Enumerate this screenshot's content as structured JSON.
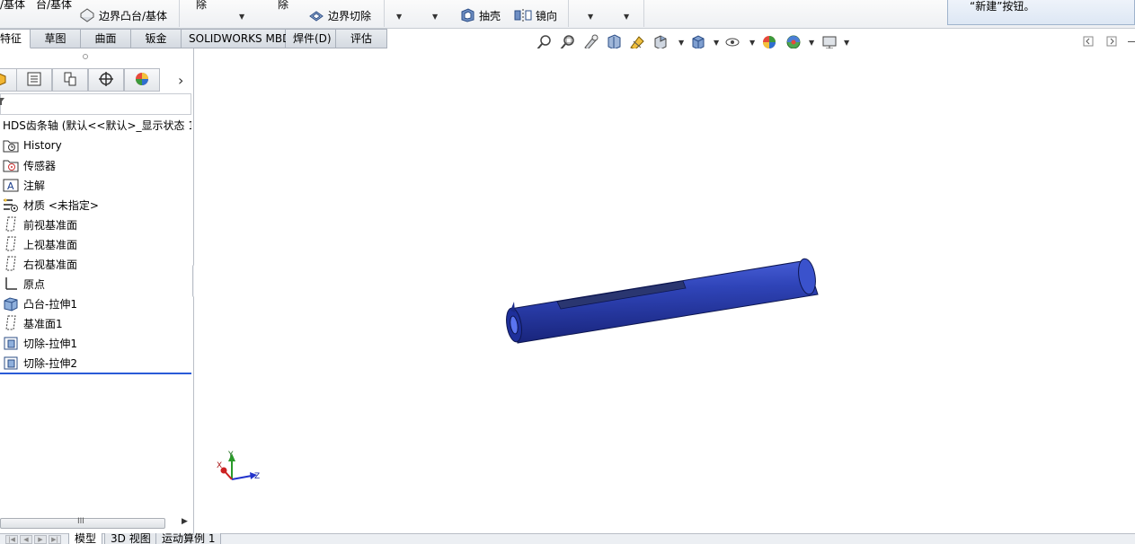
{
  "ribbon": {
    "top_fragments": [
      "/基体",
      "台/基体"
    ],
    "boundary_boss_label": "边界凸台/基体",
    "cut_fragment_1": "除",
    "cut_fragment_2": "除",
    "boundary_cut_label": "边界切除",
    "shell_label": "抽壳",
    "mirror_label": "镜向"
  },
  "tooltip": {
    "text": "“新建”按钮。"
  },
  "tabs": [
    {
      "label": "特征"
    },
    {
      "label": "草图"
    },
    {
      "label": "曲面"
    },
    {
      "label": "钣金"
    },
    {
      "label": "SOLIDWORKS MBD"
    },
    {
      "label": "焊件(D)"
    },
    {
      "label": "评估"
    }
  ],
  "tree": {
    "root_label": "HDS齿条轴 (默认<<默认>_显示状态 1",
    "nodes": [
      {
        "label": "History",
        "icon": "history-folder-icon"
      },
      {
        "label": "传感器",
        "icon": "sensor-icon"
      },
      {
        "label": "注解",
        "icon": "annotation-icon"
      },
      {
        "label": "材质 <未指定>",
        "icon": "material-icon"
      },
      {
        "label": "前视基准面",
        "icon": "plane-icon"
      },
      {
        "label": "上视基准面",
        "icon": "plane-icon"
      },
      {
        "label": "右视基准面",
        "icon": "plane-icon"
      },
      {
        "label": "原点",
        "icon": "origin-icon"
      },
      {
        "label": "凸台-拉伸1",
        "icon": "boss-extrude-icon"
      },
      {
        "label": "基准面1",
        "icon": "plane-icon"
      },
      {
        "label": "切除-拉伸1",
        "icon": "cut-extrude-icon"
      },
      {
        "label": "切除-拉伸2",
        "icon": "cut-extrude-icon"
      }
    ]
  },
  "triad": {
    "x": "X",
    "y": "Y",
    "z": "Z"
  },
  "bottom_tabs": [
    {
      "label": "模型"
    },
    {
      "label": "3D 视图"
    },
    {
      "label": "运动算例 1"
    }
  ],
  "colors": {
    "part_blue": "#2f44b8",
    "rollback_bar": "#2a5bd7",
    "axis_x": "#cc2222",
    "axis_y": "#2a9a2a",
    "axis_z": "#2233cc"
  }
}
